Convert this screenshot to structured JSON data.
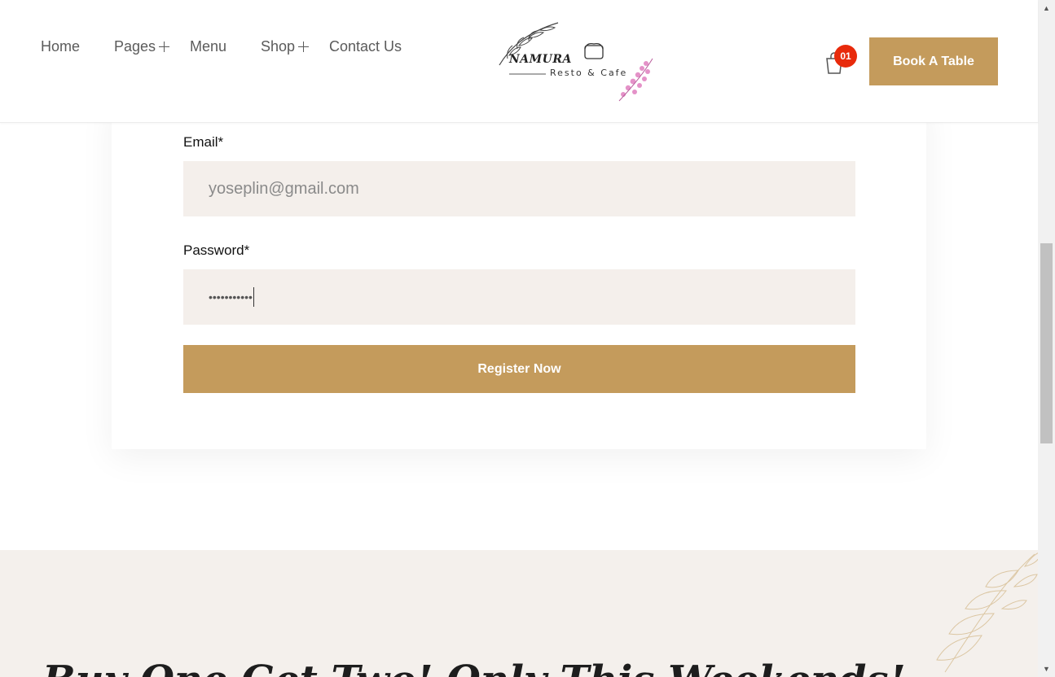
{
  "nav": {
    "home": "Home",
    "pages": "Pages",
    "menu": "Menu",
    "shop": "Shop",
    "contact": "Contact Us"
  },
  "logo": {
    "name": "NAMURA",
    "tagline": "Resto & Cafe"
  },
  "cart": {
    "count": "01"
  },
  "header_button": "Book A Table",
  "form": {
    "email_label": "Email*",
    "email_value": "yoseplin@gmail.com",
    "password_label": "Password*",
    "password_value": "•••••••••••",
    "submit_label": "Register Now"
  },
  "promo": {
    "title": "Buy One Get Two! Only This Weekends!"
  },
  "colors": {
    "accent": "#c49b5c",
    "badge": "#e82a0b",
    "field_bg": "#f4efeb",
    "section_bg": "#f4f0ec"
  },
  "icons": [
    "plus-icon",
    "cart-icon",
    "scroll-up-arrow-icon",
    "scroll-down-arrow-icon"
  ]
}
